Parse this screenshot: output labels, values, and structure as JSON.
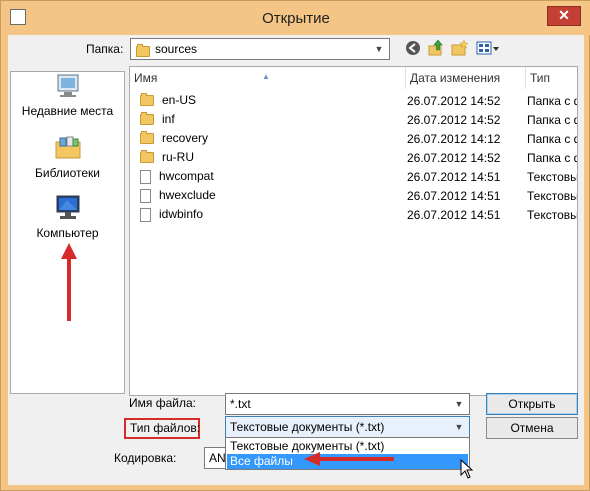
{
  "window": {
    "title": "Открытие",
    "close_glyph": "✕"
  },
  "lookin": {
    "label": "Папка:",
    "value": "sources"
  },
  "places": [
    {
      "label": "Недавние места",
      "icon": "recent-places-icon"
    },
    {
      "label": "Библиотеки",
      "icon": "libraries-icon"
    },
    {
      "label": "Компьютер",
      "icon": "computer-icon"
    }
  ],
  "columns": {
    "name": "Имя",
    "date": "Дата изменения",
    "type": "Тип"
  },
  "files": [
    {
      "name": "en-US",
      "date": "26.07.2012 14:52",
      "type": "Папка с ф",
      "kind": "folder"
    },
    {
      "name": "inf",
      "date": "26.07.2012 14:52",
      "type": "Папка с ф",
      "kind": "folder"
    },
    {
      "name": "recovery",
      "date": "26.07.2012 14:12",
      "type": "Папка с ф",
      "kind": "folder"
    },
    {
      "name": "ru-RU",
      "date": "26.07.2012 14:52",
      "type": "Папка с ф",
      "kind": "folder"
    },
    {
      "name": "hwcompat",
      "date": "26.07.2012 14:51",
      "type": "Текстовы",
      "kind": "file"
    },
    {
      "name": "hwexclude",
      "date": "26.07.2012 14:51",
      "type": "Текстовы",
      "kind": "file"
    },
    {
      "name": "idwbinfo",
      "date": "26.07.2012 14:51",
      "type": "Текстовы",
      "kind": "file"
    }
  ],
  "filename": {
    "label": "Имя файла:",
    "value": "*.txt"
  },
  "filetype": {
    "label": "Тип файлов:",
    "value": "Текстовые документы (*.txt)",
    "options": [
      "Текстовые документы (*.txt)",
      "Все файлы"
    ],
    "selected_index": 1
  },
  "encoding": {
    "label": "Кодировка:",
    "value": "ANS"
  },
  "buttons": {
    "open": "Открыть",
    "cancel": "Отмена"
  },
  "colors": {
    "frame": "#f4c584",
    "annotation": "#d52b2b",
    "selection": "#3399ff"
  }
}
